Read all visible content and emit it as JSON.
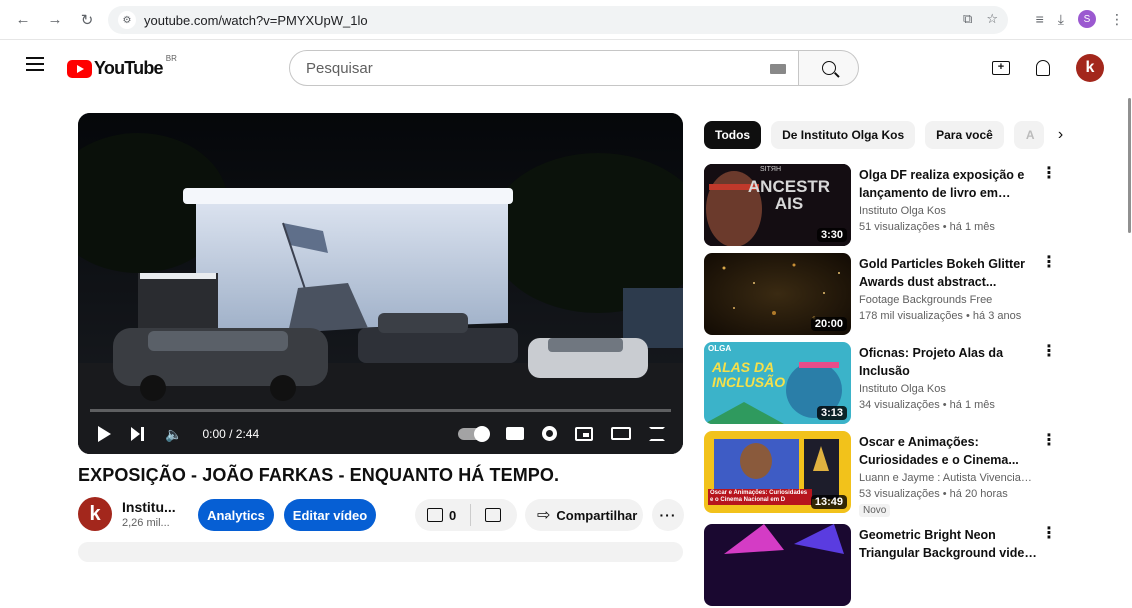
{
  "browser": {
    "url": "youtube.com/watch?v=PMYXUpW_1lo",
    "profile_initial": "S"
  },
  "header": {
    "logo_text": "YouTube",
    "region": "BR",
    "search_placeholder": "Pesquisar"
  },
  "user": {
    "avatar_initial": "k"
  },
  "player": {
    "time": "0:00 / 2:44",
    "progress_percent": 0
  },
  "video": {
    "title": "EXPOSIÇÃO - JOÃO FARKAS - ENQUANTO HÁ TEMPO.",
    "channel_name": "Institu...",
    "channel_subs": "2,26 mil...",
    "channel_initial": "k",
    "analytics_label": "Analytics",
    "edit_label": "Editar vídeo",
    "like_count": "0",
    "share_label": "Compartilhar",
    "more_label": "···"
  },
  "chips": [
    {
      "label": "Todos",
      "active": true
    },
    {
      "label": "De Instituto Olga Kos",
      "active": false
    },
    {
      "label": "Para você",
      "active": false
    },
    {
      "label": "A",
      "active": false
    }
  ],
  "recommendations": [
    {
      "title": "Olga DF realiza exposição e lançamento de livro em parcer...",
      "channel": "Instituto Olga Kos",
      "meta": "51 visualizações • há 1 mês",
      "duration": "3:30",
      "thumb_text": "ANCESTRAIS",
      "thumb_top": "SITЯH"
    },
    {
      "title": "Gold Particles Bokeh Glitter Awards dust abstract...",
      "channel": "Footage Backgrounds Free",
      "meta": "178 mil visualizações • há 3 anos",
      "duration": "20:00"
    },
    {
      "title": "Oficnas: Projeto Alas da Inclusão",
      "channel": "Instituto Olga Kos",
      "meta": "34 visualizações • há 1 mês",
      "duration": "3:13",
      "thumb_text": "ALAS DA INCLUSÃO",
      "thumb_top": "OLGA"
    },
    {
      "title": "Oscar e Animações: Curiosidades e o Cinema...",
      "channel": "Luann e Jayme : Autista Vivenciando...",
      "meta": "53 visualizações • há 20 horas",
      "duration": "13:49",
      "badge": "Novo",
      "thumb_text": "Oscar e Animações: Curiosidades e o Cinema Nacional em D"
    },
    {
      "title": "Geometric Bright Neon Triangular Background video |",
      "channel": "",
      "meta": ""
    }
  ]
}
